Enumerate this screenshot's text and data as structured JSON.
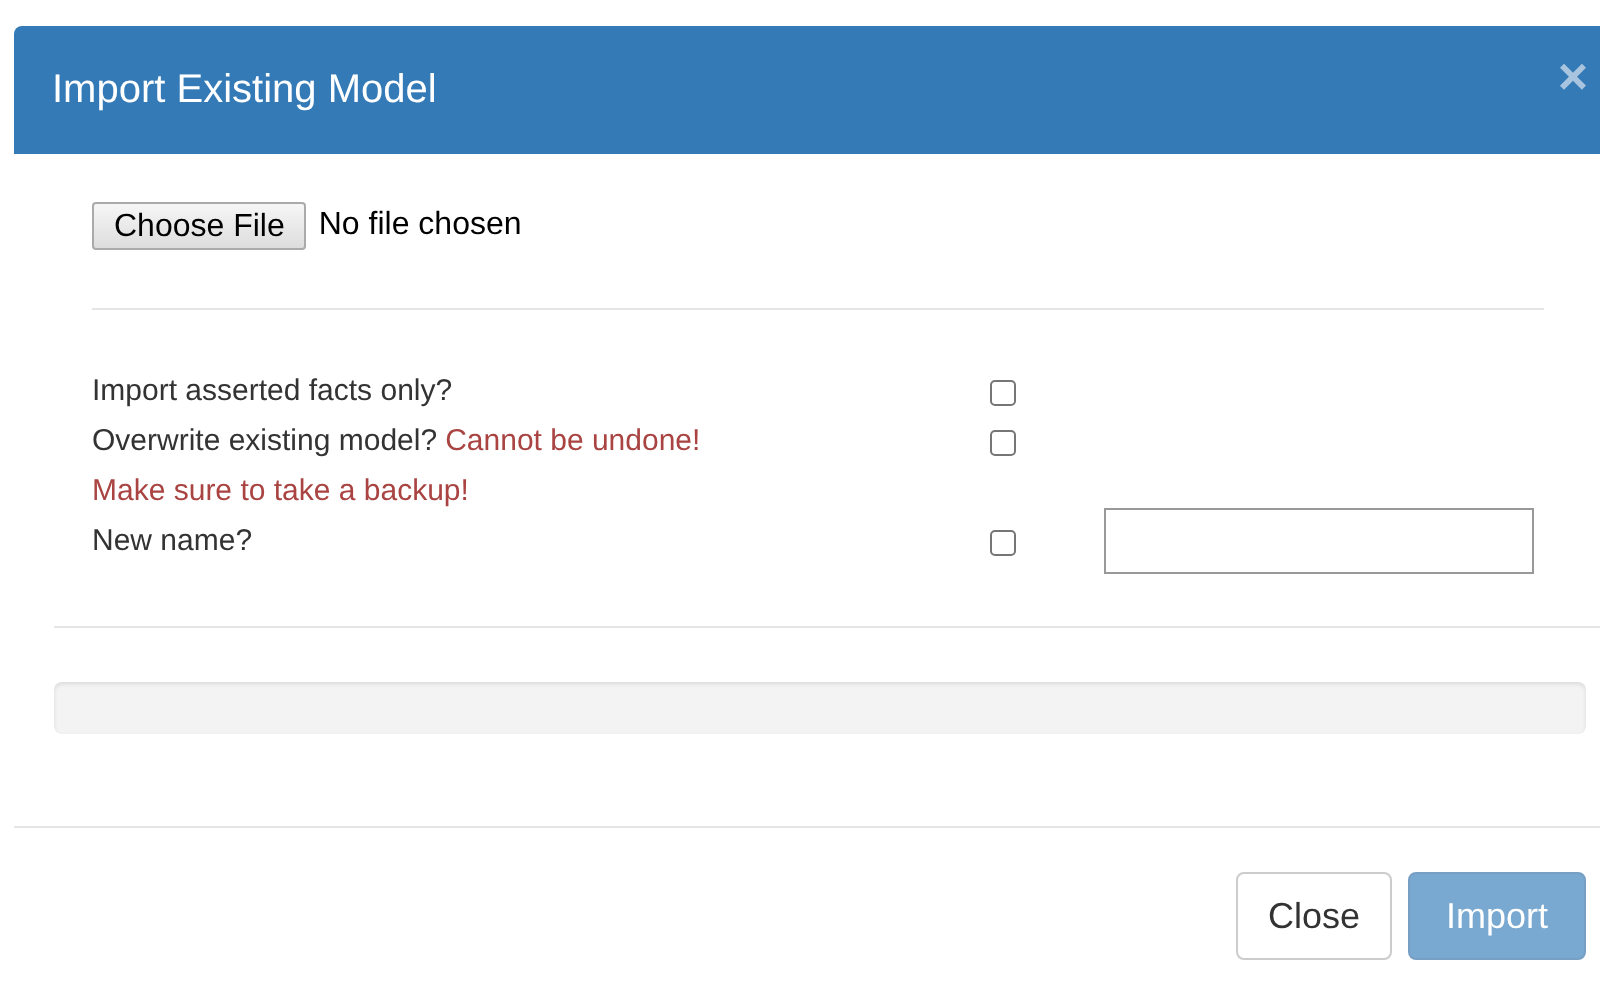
{
  "dialog": {
    "title": "Import Existing Model",
    "close_icon": "×"
  },
  "file_picker": {
    "button": "Choose File",
    "status": "No file chosen"
  },
  "options": [
    {
      "kind": "checkbox",
      "label": "Import asserted facts only?",
      "checked": false
    },
    {
      "kind": "checkbox",
      "label": "Overwrite existing model?",
      "warning": "Cannot be undone!",
      "note": "Make sure to take a backup!",
      "checked": false
    },
    {
      "kind": "checkbox_with_field",
      "label": "New name?",
      "checked": false
    }
  ],
  "progress": {
    "level": 0
  },
  "buttons": [
    {
      "label": "Close",
      "kind": "default",
      "disabled": false
    },
    {
      "label": "Import",
      "kind": "primary",
      "disabled": true
    }
  ]
}
